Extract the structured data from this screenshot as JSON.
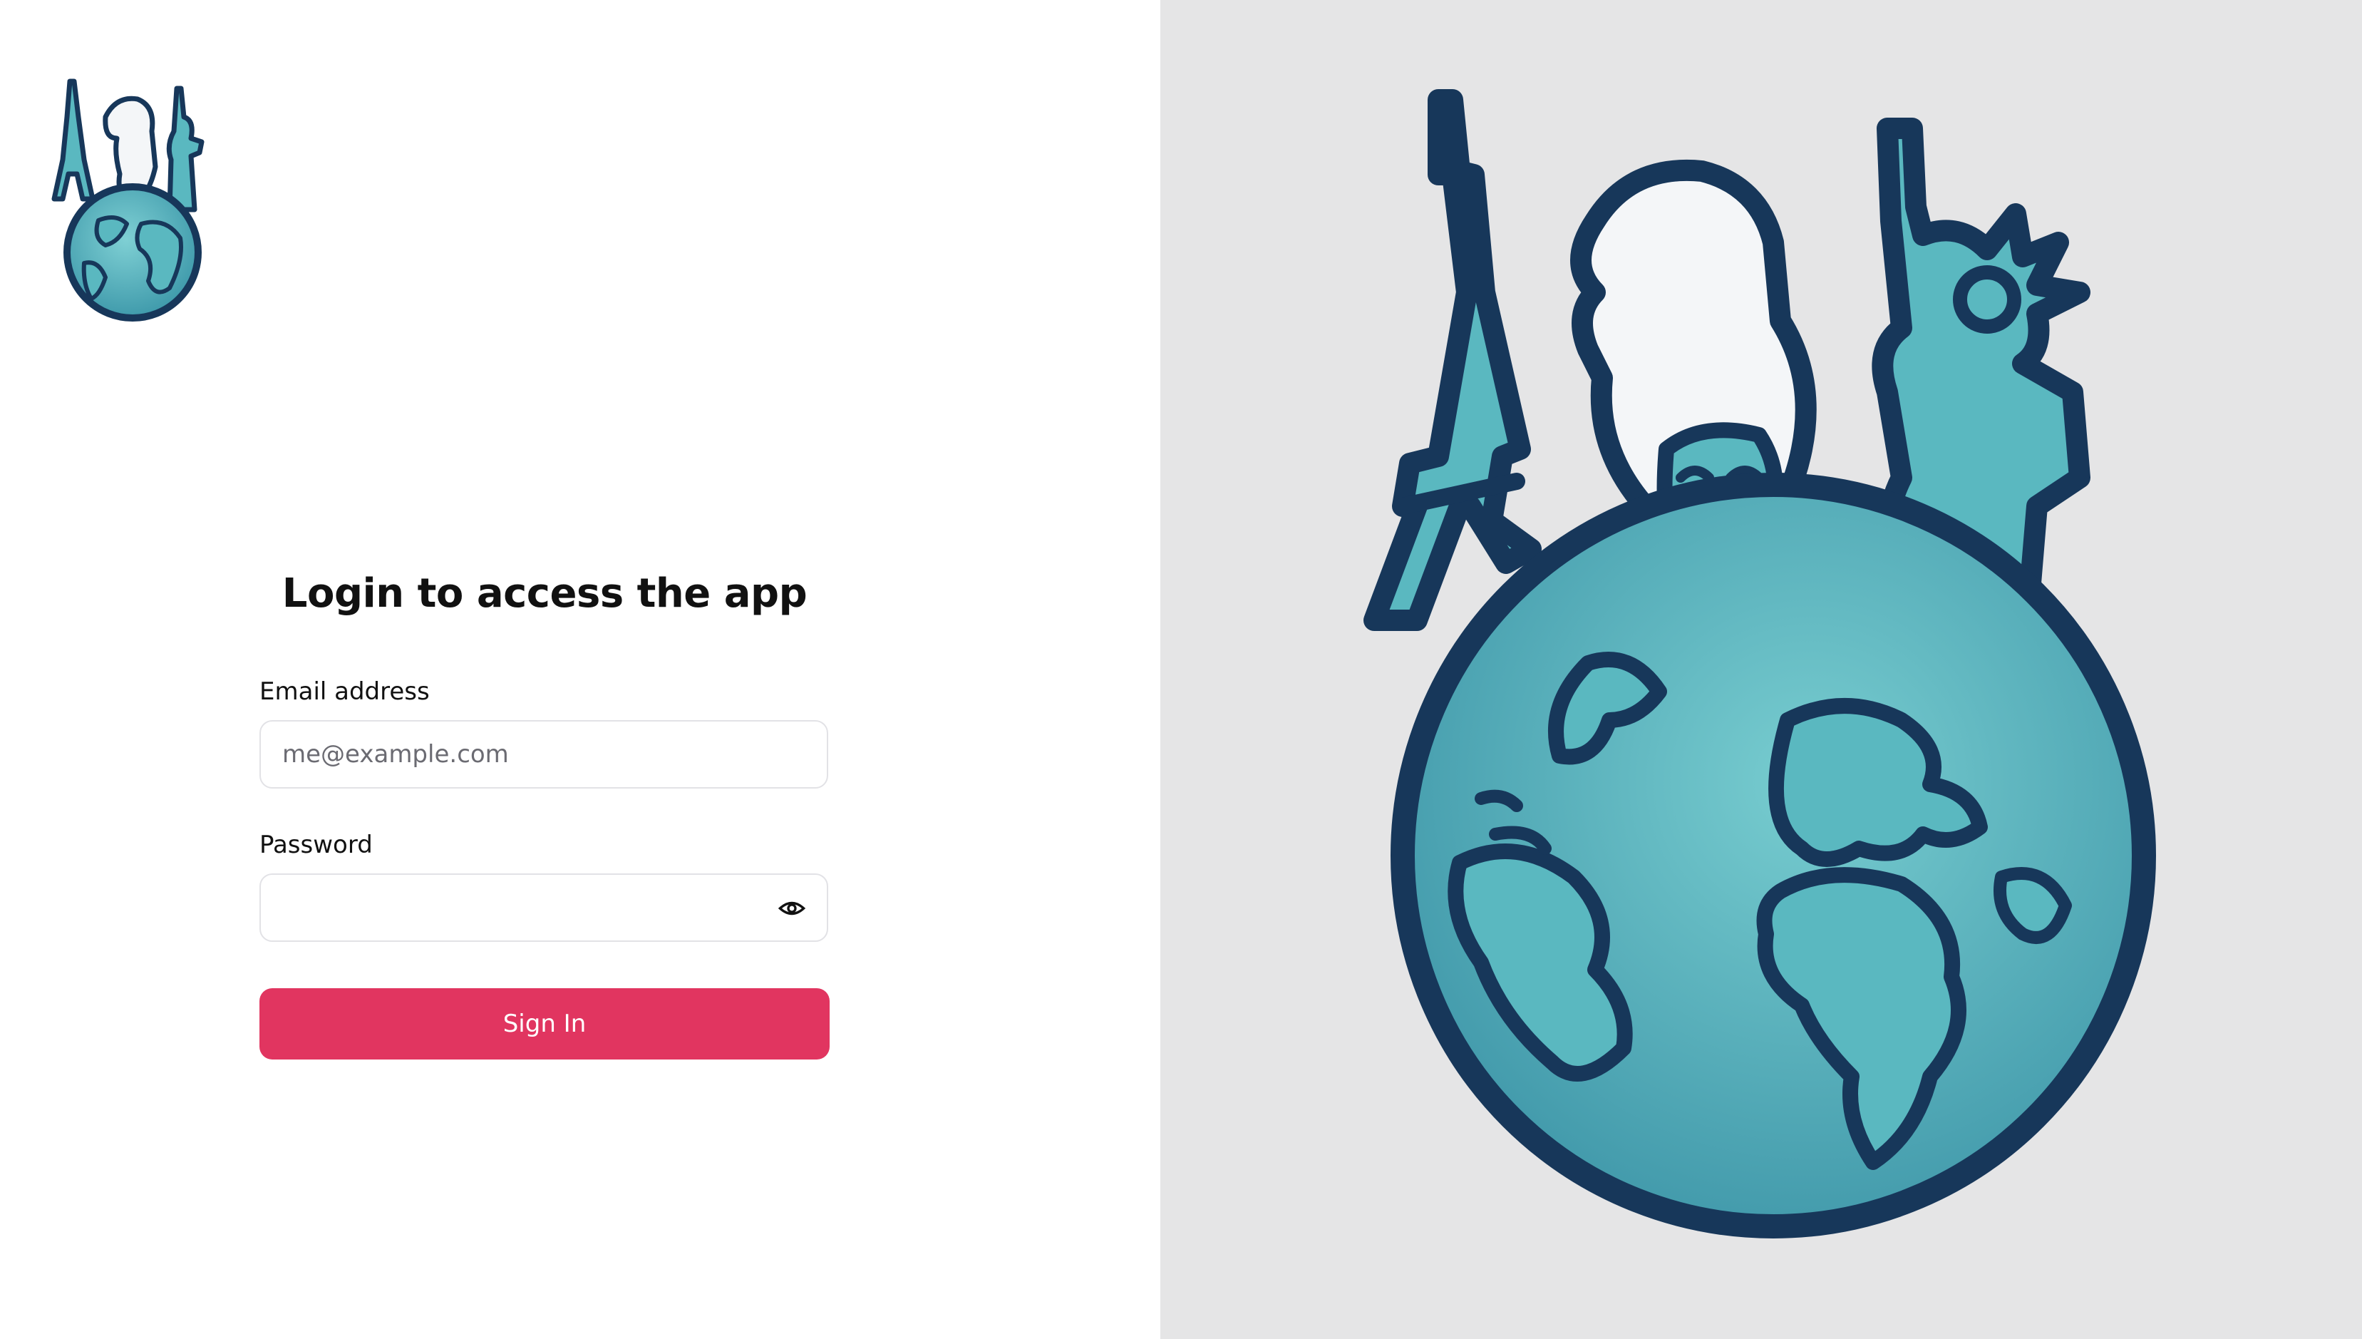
{
  "login": {
    "title": "Login to access the app",
    "email_label": "Email address",
    "email_placeholder": "me@example.com",
    "email_value": "",
    "password_label": "Password",
    "password_value": "",
    "signin_label": "Sign In"
  },
  "icons": {
    "logo": "globe-landmarks-logo",
    "toggle_password": "eye-icon",
    "hero": "globe-landmarks-illustration"
  },
  "colors": {
    "primary_button": "#e13560",
    "globe_dark": "#17375a",
    "globe_teal": "#5ab8c0",
    "right_pane_bg": "#e5e5e6"
  }
}
